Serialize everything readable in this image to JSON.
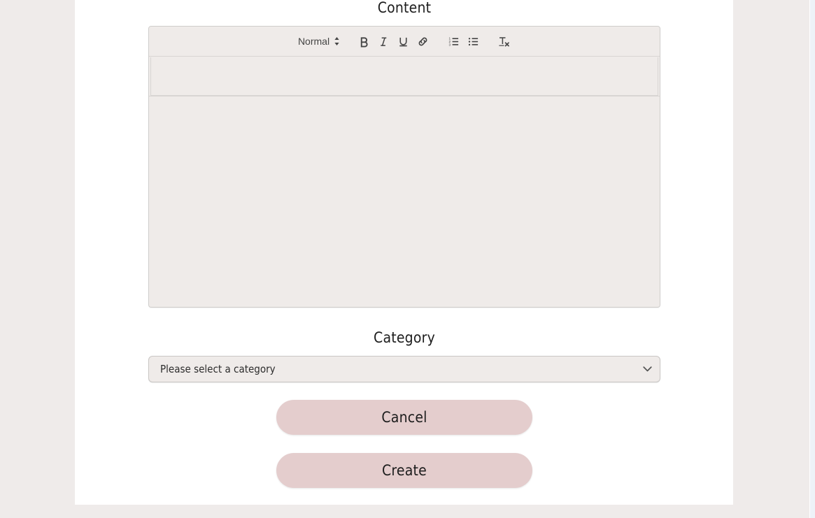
{
  "form": {
    "content": {
      "label": "Content",
      "editor": {
        "toolbar": {
          "format_picker": {
            "value": "Normal",
            "caret_icon": "chevron-updown-icon"
          },
          "buttons": [
            {
              "name": "bold-button",
              "icon": "bold-icon",
              "title": "Bold"
            },
            {
              "name": "italic-button",
              "icon": "italic-icon",
              "title": "Italic"
            },
            {
              "name": "underline-button",
              "icon": "underline-icon",
              "title": "Underline"
            },
            {
              "name": "link-button",
              "icon": "link-icon",
              "title": "Link"
            },
            {
              "name": "ordered-list-button",
              "icon": "ordered-list-icon",
              "title": "Ordered List"
            },
            {
              "name": "bullet-list-button",
              "icon": "bullet-list-icon",
              "title": "Bullet List"
            },
            {
              "name": "clear-format-button",
              "icon": "clear-formatting-icon",
              "title": "Clear Formatting"
            }
          ]
        },
        "title_value": "",
        "body_value": ""
      }
    },
    "category": {
      "label": "Category",
      "select": {
        "selected": "Please select a category",
        "options": [
          "Please select a category"
        ],
        "chevron_icon": "chevron-down-icon"
      }
    },
    "actions": {
      "cancel_label": "Cancel",
      "create_label": "Create"
    }
  },
  "colors": {
    "page_background": "#efebea",
    "card_background": "#ffffff",
    "editor_background": "#efebe9",
    "editor_border": "#cfcdcb",
    "button_background": "#e4cdcd",
    "text": "#1d1d1d",
    "scrollbar_track": "#eef2f8"
  }
}
